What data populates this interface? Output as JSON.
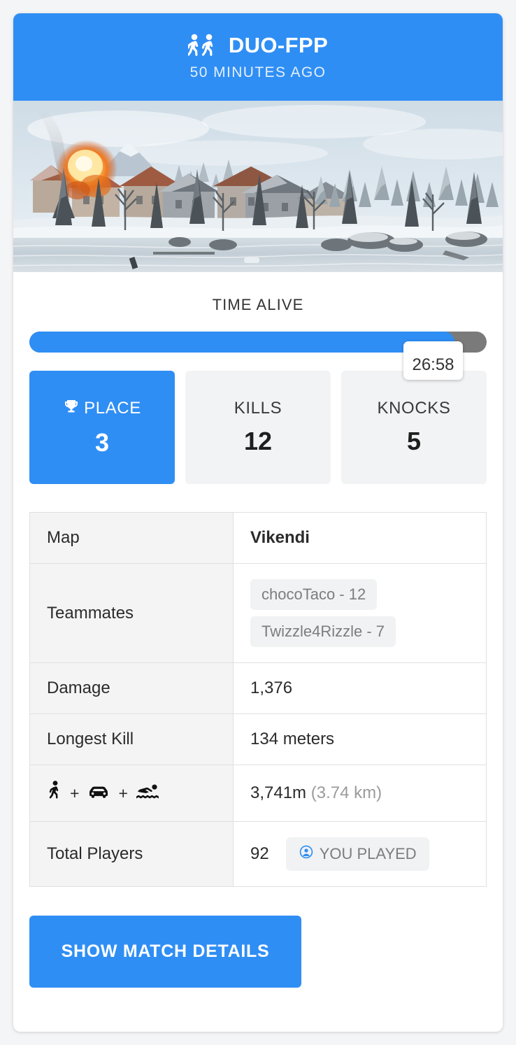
{
  "theme": {
    "accent": "#2f8ef4",
    "track": "#7a7a7a",
    "panel": "#f2f3f4"
  },
  "header": {
    "mode": "DUO-FPP",
    "time_ago": "50 MINUTES AGO",
    "icon": "two-walkers-icon"
  },
  "hero": {
    "alt": "Vikendi snowy village with explosion over frozen lake"
  },
  "time_alive": {
    "label": "TIME ALIVE",
    "value": "26:58",
    "percent": 93
  },
  "stats": [
    {
      "label": "PLACE",
      "value": "3",
      "icon": "trophy-icon",
      "primary": true
    },
    {
      "label": "KILLS",
      "value": "12",
      "icon": null,
      "primary": false
    },
    {
      "label": "KNOCKS",
      "value": "5",
      "icon": null,
      "primary": false
    }
  ],
  "details": {
    "map": {
      "label": "Map",
      "value": "Vikendi"
    },
    "teammates": {
      "label": "Teammates",
      "items": [
        "chocoTaco - 12",
        "Twizzle4Rizzle - 7"
      ]
    },
    "damage": {
      "label": "Damage",
      "value": "1,376"
    },
    "longest_kill": {
      "label": "Longest Kill",
      "value": "134 meters"
    },
    "distance": {
      "icons": [
        "walk-icon",
        "car-icon",
        "swim-icon"
      ],
      "separator": "+",
      "value": "3,741m",
      "value_alt": "(3.74 km)"
    },
    "total_players": {
      "label": "Total Players",
      "value": "92",
      "badge": "YOU PLAYED",
      "badge_icon": "person-circle-icon"
    }
  },
  "footer": {
    "button": "SHOW MATCH DETAILS"
  }
}
